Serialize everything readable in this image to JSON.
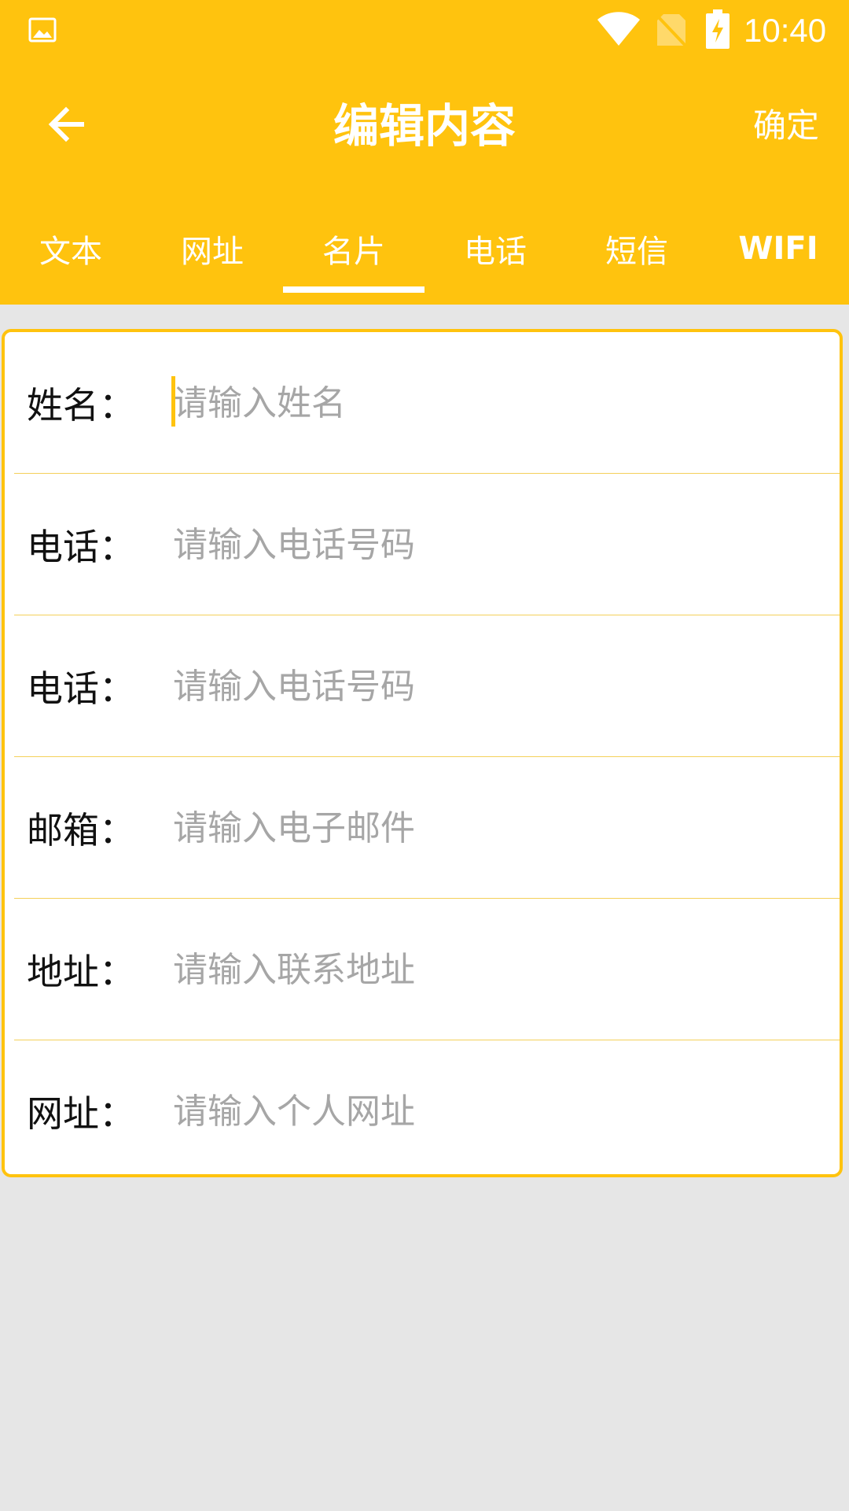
{
  "status_bar": {
    "time": "10:40",
    "icons": [
      "gallery-icon",
      "wifi-icon",
      "no-sim-icon",
      "battery-charging-icon"
    ]
  },
  "toolbar": {
    "back_icon": "arrow-left-icon",
    "title": "编辑内容",
    "confirm_label": "确定"
  },
  "tabs": [
    {
      "label": "文本",
      "active": false
    },
    {
      "label": "网址",
      "active": false
    },
    {
      "label": "名片",
      "active": true
    },
    {
      "label": "电话",
      "active": false
    },
    {
      "label": "短信",
      "active": false
    },
    {
      "label": "WIFI",
      "active": false
    }
  ],
  "form": {
    "fields": [
      {
        "label": "姓名：",
        "placeholder": "请输入姓名",
        "value": ""
      },
      {
        "label": "电话：",
        "placeholder": "请输入电话号码",
        "value": ""
      },
      {
        "label": "电话：",
        "placeholder": "请输入电话号码",
        "value": ""
      },
      {
        "label": "邮箱：",
        "placeholder": "请输入电子邮件",
        "value": ""
      },
      {
        "label": "地址：",
        "placeholder": "请输入联系地址",
        "value": ""
      },
      {
        "label": "网址：",
        "placeholder": "请输入个人网址",
        "value": ""
      }
    ]
  },
  "colors": {
    "accent": "#FFC30E",
    "background": "#E6E6E6",
    "divider": "#F4D05A",
    "placeholder": "#A6A6A6"
  }
}
